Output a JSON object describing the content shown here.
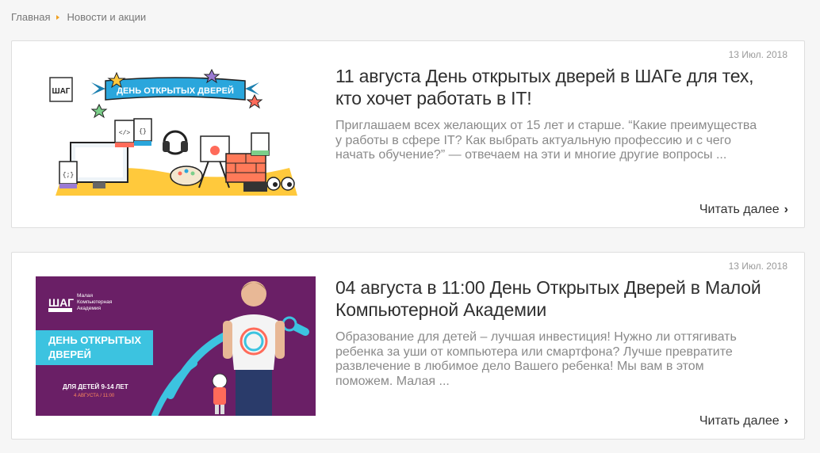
{
  "breadcrumb": {
    "home": "Главная",
    "current": "Новости и акции"
  },
  "read_more_label": "Читать далее",
  "articles": [
    {
      "date": "13 Июл. 2018",
      "title": "11 августа День открытых дверей в ШАГе для тех, кто хочет работать в IT!",
      "excerpt": "Приглашаем всех желающих от 15 лет и старше. “Какие преимущества у работы в сфере IT? Как выбрать актуальную профессию и с чего начать обучение?” — отвечаем на эти и многие другие вопросы ...",
      "image": {
        "logo": "ШАГ",
        "ribbon": "ДЕНЬ ОТКРЫТЫХ ДВЕРЕЙ",
        "tags": [
          "CSS",
          "HTML",
          "PSD",
          "JS"
        ]
      }
    },
    {
      "date": "13 Июл. 2018",
      "title": "04 августа в 11:00 День Открытых Дверей в Малой Компьютерной Академии",
      "excerpt": "Образование для детей – лучшая инвестиция! Нужно ли оттягивать ребенка за уши от компьютера или смартфона? Лучше превратите развлечение в любимое дело Вашего ребенка! Мы вам в этом поможем. Малая ...",
      "image": {
        "logo": "ШАГ",
        "logo_sub": "Малая Компьютерная Академия",
        "banner_line1": "ДЕНЬ ОТКРЫТЫХ",
        "banner_line2": "ДВЕРЕЙ",
        "ages": "ДЛЯ ДЕТЕЙ 9-14 ЛЕТ",
        "event_date": "4 АВГУСТА / 11:00"
      }
    }
  ],
  "colors": {
    "accent_arrow": "#f0a020",
    "banner1_ribbon": "#2aa6dc",
    "banner2_bg": "#6a1f66",
    "banner2_label": "#3cc3e0"
  }
}
